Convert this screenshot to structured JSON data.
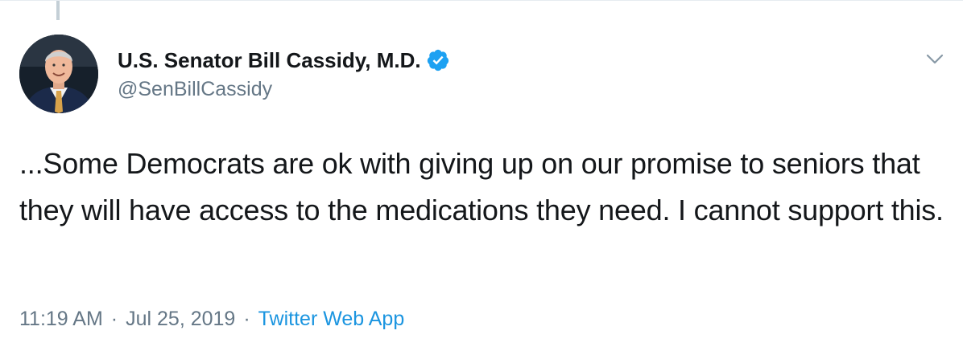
{
  "tweet": {
    "author": {
      "display_name": "U.S. Senator Bill Cassidy, M.D.",
      "handle": "@SenBillCassidy",
      "verified": true,
      "avatar_icon": "profile-photo"
    },
    "text": "...Some Democrats are ok with giving up on our promise to seniors that they will have access to the medications they need. I cannot support this.",
    "time": "11:19 AM",
    "date": "Jul 25, 2019",
    "separator": "·",
    "source": "Twitter Web App"
  },
  "colors": {
    "text_primary": "#14171a",
    "text_secondary": "#657786",
    "link": "#1b95e0",
    "verified_badge": "#1da1f2"
  },
  "icons": {
    "menu": "chevron-down-icon",
    "verified": "verified-badge-icon"
  }
}
